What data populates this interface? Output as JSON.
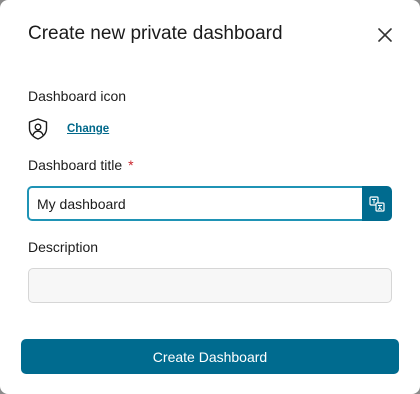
{
  "dialog": {
    "title": "Create new private dashboard",
    "close_icon": "close-icon"
  },
  "icon_section": {
    "label": "Dashboard icon",
    "icon": "shield-person-icon",
    "change_link": "Change"
  },
  "title_field": {
    "label": "Dashboard title",
    "required_marker": "*",
    "value": "My dashboard",
    "translate_icon": "translate-icon"
  },
  "description_field": {
    "label": "Description",
    "value": ""
  },
  "actions": {
    "create_label": "Create Dashboard"
  },
  "colors": {
    "primary": "#006b8f",
    "focus_border": "#1f93b5",
    "link": "#00688a",
    "required": "#c9252d"
  }
}
